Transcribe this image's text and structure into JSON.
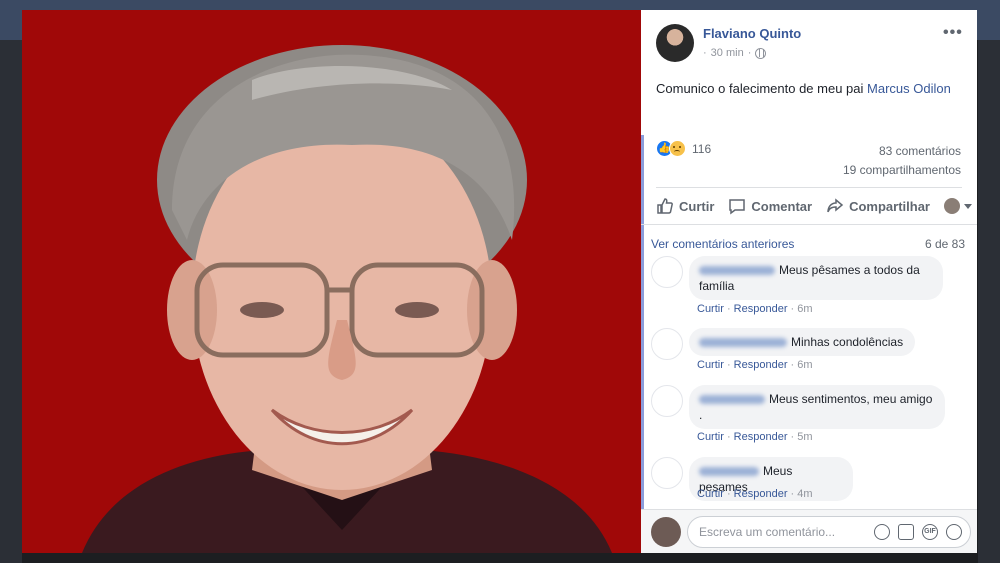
{
  "post": {
    "author": "Flaviano Quinto",
    "time": "30 min",
    "text_prefix": "Comunico o falecimento de meu pai",
    "mention": "Marcus Odilon",
    "more": "•••",
    "reactions": {
      "count": "116"
    },
    "comments_count": "83 comentários",
    "shares_count": "19 compartilhamentos"
  },
  "actions": {
    "like": "Curtir",
    "comment": "Comentar",
    "share": "Compartilhar"
  },
  "comments_header": {
    "previous": "Ver comentários anteriores",
    "page": "6 de 83"
  },
  "comments": [
    {
      "line1": "Meus pêsames a todos da",
      "line2": "família",
      "like": "Curtir",
      "reply": "Responder",
      "time": "6m"
    },
    {
      "line1": "Minhas condolências",
      "like": "Curtir",
      "reply": "Responder",
      "time": "6m"
    },
    {
      "line1": "Meus sentimentos, meu amigo",
      "line2": ".",
      "like": "Curtir",
      "reply": "Responder",
      "time": "5m"
    },
    {
      "line1": "Meus pesames",
      "like": "Curtir",
      "reply": "Responder",
      "time": "4m"
    }
  ],
  "composer": {
    "placeholder": "Escreva um comentário...",
    "icons": [
      "emoji-icon",
      "camera-icon",
      "gif-icon",
      "sticker-icon"
    ],
    "gif_label": "GIF"
  },
  "colors": {
    "photo_bg": "#a00808",
    "link": "#385898"
  }
}
